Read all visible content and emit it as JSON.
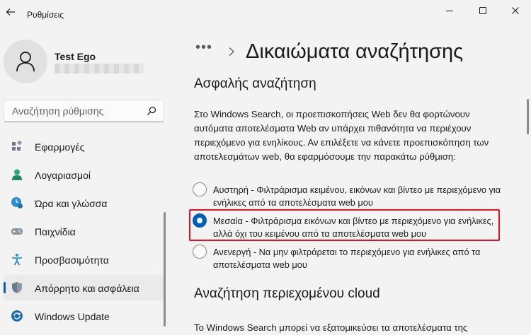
{
  "window": {
    "title": "Ρυθμίσεις"
  },
  "profile": {
    "name": "Test Ego"
  },
  "search": {
    "placeholder": "Αναζήτηση ρύθμισης"
  },
  "sidebar": {
    "items": [
      {
        "label": "Εφαρμογές",
        "icon": "apps-icon"
      },
      {
        "label": "Λογαριασμοί",
        "icon": "accounts-icon"
      },
      {
        "label": "Ώρα και γλώσσα",
        "icon": "time-language-icon"
      },
      {
        "label": "Παιχνίδια",
        "icon": "gaming-icon"
      },
      {
        "label": "Προσβασιμότητα",
        "icon": "accessibility-icon"
      },
      {
        "label": "Απόρρητο και ασφάλεια",
        "icon": "shield-icon",
        "selected": true
      },
      {
        "label": "Windows Update",
        "icon": "update-icon"
      }
    ]
  },
  "breadcrumb": {
    "more": "•••",
    "title": "Δικαιώματα αναζήτησης"
  },
  "safe_search": {
    "heading": "Ασφαλής αναζήτηση",
    "description": "Στο Windows Search, οι προεπισκοπήσεις Web δεν θα φορτώνουν αυτόματα αποτελέσματα Web αν υπάρχει πιθανότητα να περιέχουν περιεχόμενο για ενηλίκους. Αν επιλέξετε να κάνετε προεπισκόπηση των αποτελεσμάτων web, θα εφαρμόσουμε την παρακάτω ρύθμιση:",
    "options": [
      {
        "label": "Αυστηρή - Φιλτράρισμα κειμένου, εικόνων και βίντεο με περιεχόμενο για ενήλικες από τα αποτελέσματα web μου",
        "checked": false
      },
      {
        "label": "Μεσαία - Φιλτράρισμα εικόνων και βίντεο με περιεχόμενο για ενήλικες, αλλά όχι του κειμένου από τα αποτελέσματα web μου",
        "checked": true
      },
      {
        "label": "Ανενεργή - Να μην φιλτράρεται το περιεχόμενο για ενήλικες από τα αποτελέσματα web μου",
        "checked": false
      }
    ]
  },
  "cloud_search": {
    "heading": "Αναζήτηση περιεχομένου cloud",
    "description": "Το Windows Search μπορεί να εξατομικεύσει τα αποτελέσματα της"
  },
  "colors": {
    "accent": "#005fb8",
    "highlight": "#e81123",
    "background": "#f3f3f3"
  }
}
